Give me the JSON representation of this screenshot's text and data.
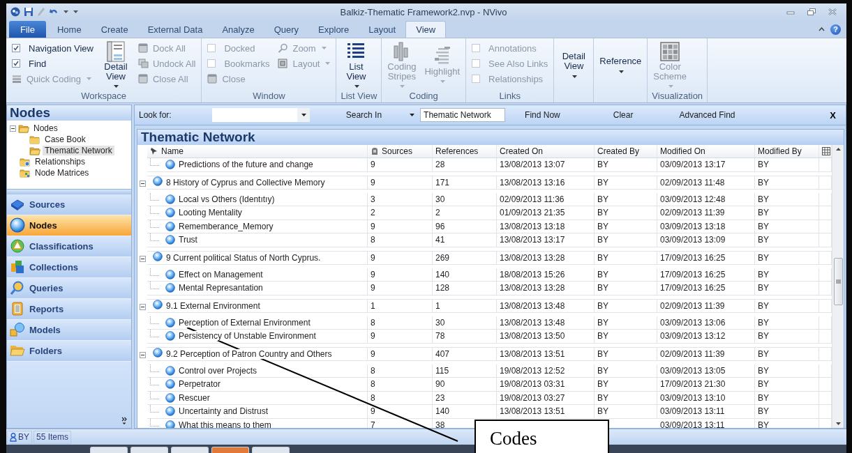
{
  "window": {
    "title": "Balkiz-Thematic Framework2.nvp - NVivo",
    "help": "?"
  },
  "ribbon_tabs": [
    {
      "label": "File",
      "kind": "file",
      "selected": false
    },
    {
      "label": "Home",
      "kind": "tab",
      "selected": false
    },
    {
      "label": "Create",
      "kind": "tab",
      "selected": false
    },
    {
      "label": "External Data",
      "kind": "tab",
      "selected": false
    },
    {
      "label": "Analyze",
      "kind": "tab",
      "selected": false
    },
    {
      "label": "Query",
      "kind": "tab",
      "selected": false
    },
    {
      "label": "Explore",
      "kind": "tab",
      "selected": false
    },
    {
      "label": "Layout",
      "kind": "tab",
      "selected": false
    },
    {
      "label": "View",
      "kind": "tab",
      "selected": true
    }
  ],
  "ribbon_groups": [
    {
      "label": "Workspace",
      "columns": [
        [
          {
            "kind": "check",
            "label": "Navigation View",
            "checked": true,
            "disabled": false
          },
          {
            "kind": "check",
            "label": "Find",
            "checked": true,
            "disabled": false
          },
          {
            "kind": "small",
            "label": "Quick Coding",
            "dropdown": true,
            "disabled": true
          }
        ],
        [
          {
            "kind": "large",
            "label": "Detail View",
            "dropdown": true,
            "disabled": false
          }
        ],
        [
          {
            "kind": "small",
            "label": "Dock All",
            "dropdown": false,
            "disabled": true
          },
          {
            "kind": "small",
            "label": "Undock All",
            "dropdown": false,
            "disabled": true
          },
          {
            "kind": "small",
            "label": "Close All",
            "dropdown": false,
            "disabled": true
          }
        ]
      ]
    },
    {
      "label": "Window",
      "columns": [
        [
          {
            "kind": "check",
            "label": "Docked",
            "checked": false,
            "disabled": true
          },
          {
            "kind": "check",
            "label": "Bookmarks",
            "checked": false,
            "disabled": true
          },
          {
            "kind": "small",
            "label": "Close",
            "dropdown": false,
            "disabled": true
          }
        ],
        [
          {
            "kind": "small",
            "label": "Zoom",
            "dropdown": true,
            "disabled": true
          },
          {
            "kind": "small",
            "label": "Layout",
            "dropdown": true,
            "disabled": true
          }
        ]
      ]
    },
    {
      "label": "List View",
      "columns": [
        [
          {
            "kind": "large",
            "label": "List View",
            "dropdown": true,
            "disabled": false
          }
        ]
      ]
    },
    {
      "label": "Coding",
      "columns": [
        [
          {
            "kind": "large",
            "label": "Coding Stripes",
            "dropdown": true,
            "disabled": true
          }
        ],
        [
          {
            "kind": "large",
            "label": "Highlight",
            "dropdown": true,
            "disabled": true
          }
        ]
      ]
    },
    {
      "label": "Links",
      "columns": [
        [
          {
            "kind": "check",
            "label": "Annotations",
            "checked": false,
            "disabled": true
          },
          {
            "kind": "check",
            "label": "See Also Links",
            "checked": false,
            "disabled": true
          },
          {
            "kind": "check",
            "label": "Relationships",
            "checked": false,
            "disabled": true
          }
        ]
      ]
    },
    {
      "columns": [
        [
          {
            "kind": "large",
            "label": "Detail View",
            "dropdown": true,
            "disabled": false
          }
        ]
      ]
    },
    {
      "columns": [
        [
          {
            "kind": "large",
            "label": "Reference",
            "dropdown": true,
            "disabled": false
          }
        ]
      ]
    },
    {
      "label": "Visualization",
      "columns": [
        [
          {
            "kind": "large",
            "label": "Color Scheme",
            "dropdown": true,
            "disabled": true
          }
        ]
      ]
    }
  ],
  "sidebar": {
    "title": "Nodes",
    "tree": [
      {
        "label": "Nodes",
        "expanded": true,
        "selected": false,
        "children": [
          {
            "label": "Case Book",
            "selected": false
          },
          {
            "label": "Thematic Network",
            "selected": true
          }
        ]
      },
      {
        "label": "Relationships",
        "selected": false
      },
      {
        "label": "Node Matrices",
        "selected": false
      }
    ],
    "nav": [
      {
        "label": "Sources",
        "selected": false
      },
      {
        "label": "Nodes",
        "selected": true
      },
      {
        "label": "Classifications",
        "selected": false
      },
      {
        "label": "Collections",
        "selected": false
      },
      {
        "label": "Queries",
        "selected": false
      },
      {
        "label": "Reports",
        "selected": false
      },
      {
        "label": "Models",
        "selected": false
      },
      {
        "label": "Folders",
        "selected": false
      }
    ]
  },
  "find_bar": {
    "label": "Look for:",
    "search_in": "Search In",
    "search_in_value": "Thematic Network",
    "buttons": [
      "Find Now",
      "Clear",
      "Advanced Find"
    ],
    "close": "X"
  },
  "table": {
    "title": "Thematic Network",
    "columns": [
      "Name",
      "Sources",
      "References",
      "Created On",
      "Created By",
      "Modified On",
      "Modified By"
    ],
    "rows": [
      {
        "kind": "child",
        "name": "Predictions of the future and change",
        "sources": "9",
        "references": "28",
        "created_on": "13/08/2013 13:07",
        "created_by": "BY",
        "modified_on": "03/09/2013 13:17",
        "modified_by": "BY"
      },
      {
        "kind": "parent",
        "expanded": true,
        "name": "8 History of Cyprus and Collective Memory",
        "sources": "9",
        "references": "171",
        "created_on": "13/08/2013 13:16",
        "created_by": "BY",
        "modified_on": "02/09/2013 11:48",
        "modified_by": "BY"
      },
      {
        "kind": "child",
        "name": "Local vs Others (Identıtıy)",
        "sources": "3",
        "references": "30",
        "created_on": "02/09/2013 11:36",
        "created_by": "BY",
        "modified_on": "03/09/2013 12:48",
        "modified_by": "BY"
      },
      {
        "kind": "child",
        "name": "Looting Mentality",
        "sources": "2",
        "references": "2",
        "created_on": "01/09/2013 21:35",
        "created_by": "BY",
        "modified_on": "02/09/2013 11:39",
        "modified_by": "BY"
      },
      {
        "kind": "child",
        "name": "Rememberance_Memory",
        "sources": "9",
        "references": "96",
        "created_on": "13/08/2013 13:18",
        "created_by": "BY",
        "modified_on": "03/09/2013 13:18",
        "modified_by": "BY"
      },
      {
        "kind": "child",
        "name": "Trust",
        "sources": "8",
        "references": "41",
        "created_on": "13/08/2013 13:17",
        "created_by": "BY",
        "modified_on": "03/09/2013 13:09",
        "modified_by": "BY"
      },
      {
        "kind": "parent",
        "expanded": true,
        "name": "9 Current political Status of North Cyprus.",
        "sources": "9",
        "references": "269",
        "created_on": "13/08/2013 13:28",
        "created_by": "BY",
        "modified_on": "17/09/2013 16:25",
        "modified_by": "BY"
      },
      {
        "kind": "child",
        "name": "Effect on Management",
        "sources": "9",
        "references": "140",
        "created_on": "18/08/2013 15:26",
        "created_by": "BY",
        "modified_on": "17/09/2013 16:25",
        "modified_by": "BY"
      },
      {
        "kind": "child",
        "name": "Mental Represantation",
        "sources": "9",
        "references": "128",
        "created_on": "13/08/2013 13:28",
        "created_by": "BY",
        "modified_on": "17/09/2013 16:25",
        "modified_by": "BY"
      },
      {
        "kind": "parent",
        "expanded": true,
        "name": "9.1 External Environment",
        "sources": "1",
        "references": "1",
        "created_on": "13/08/2013 13:48",
        "created_by": "BY",
        "modified_on": "02/09/2013 11:39",
        "modified_by": "BY"
      },
      {
        "kind": "child",
        "name": "Perception of External Environment",
        "sources": "8",
        "references": "30",
        "created_on": "13/08/2013 13:48",
        "created_by": "BY",
        "modified_on": "03/09/2013 13:06",
        "modified_by": "BY"
      },
      {
        "kind": "child",
        "name": "Persistency of Unstable Environment",
        "sources": "9",
        "references": "78",
        "created_on": "13/08/2013 13:50",
        "created_by": "BY",
        "modified_on": "03/09/2013 13:12",
        "modified_by": "BY"
      },
      {
        "kind": "parent",
        "expanded": true,
        "name": "9.2 Perception of Patron Country and Others",
        "sources": "9",
        "references": "407",
        "created_on": "13/08/2013 13:51",
        "created_by": "BY",
        "modified_on": "02/09/2013 11:39",
        "modified_by": "BY"
      },
      {
        "kind": "child",
        "name": "Control over Projects",
        "sources": "8",
        "references": "115",
        "created_on": "19/08/2013 12:52",
        "created_by": "BY",
        "modified_on": "03/09/2013 13:05",
        "modified_by": "BY"
      },
      {
        "kind": "child",
        "name": "Perpetrator",
        "sources": "8",
        "references": "90",
        "created_on": "19/08/2013 03:31",
        "created_by": "BY",
        "modified_on": "17/09/2013 21:30",
        "modified_by": "BY"
      },
      {
        "kind": "child",
        "name": "Rescuer",
        "sources": "8",
        "references": "23",
        "created_on": "19/08/2013 03:27",
        "created_by": "BY",
        "modified_on": "03/09/2013 13:10",
        "modified_by": "BY"
      },
      {
        "kind": "child",
        "name": "Uncertainty and Distrust",
        "sources": "9",
        "references": "140",
        "created_on": "13/08/2013 13:51",
        "created_by": "BY",
        "modified_on": "03/09/2013 13:11",
        "modified_by": "BY"
      },
      {
        "kind": "child",
        "name": "What this means to them",
        "sources": "7",
        "references": "38",
        "modified_on": "03/09/2013 13:11",
        "modified_by": "BY"
      }
    ]
  },
  "status_bar": {
    "user": "BY",
    "items": "55 Items"
  },
  "annotation": {
    "label": "Codes"
  }
}
